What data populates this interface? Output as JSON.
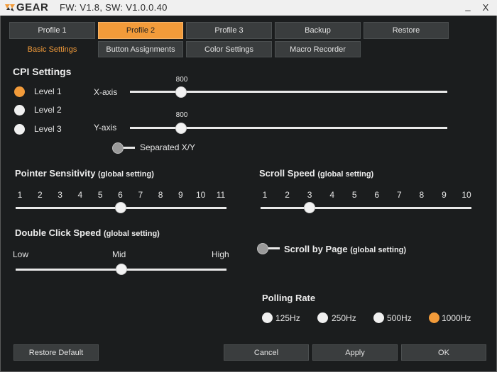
{
  "title_bar": {
    "logo_text": "GEAR",
    "version": "FW: V1.8, SW: V1.0.0.40",
    "minimize_label": "_",
    "close_label": "X"
  },
  "profile_tabs": [
    {
      "label": "Profile 1",
      "active": false
    },
    {
      "label": "Profile 2",
      "active": true
    },
    {
      "label": "Profile 3",
      "active": false
    },
    {
      "label": "Backup",
      "active": false
    },
    {
      "label": "Restore",
      "active": false
    }
  ],
  "settings_tabs": [
    {
      "label": "Basic Settings",
      "active": true
    },
    {
      "label": "Button Assignments",
      "active": false
    },
    {
      "label": "Color Settings",
      "active": false
    },
    {
      "label": "Macro Recorder",
      "active": false
    }
  ],
  "cpi": {
    "heading": "CPI Settings",
    "levels": [
      {
        "label": "Level 1",
        "selected": true
      },
      {
        "label": "Level 2",
        "selected": false
      },
      {
        "label": "Level 3",
        "selected": false
      }
    ],
    "x_axis": {
      "label": "X-axis",
      "value": "800",
      "fraction": 0.16
    },
    "y_axis": {
      "label": "Y-axis",
      "value": "800",
      "fraction": 0.16
    },
    "separated_label": "Separated X/Y"
  },
  "pointer": {
    "heading": "Pointer Sensitivity",
    "note": "(global setting)",
    "ticks": [
      "1",
      "2",
      "3",
      "4",
      "5",
      "6",
      "7",
      "8",
      "9",
      "10",
      "11"
    ],
    "selected_index": 5
  },
  "scroll": {
    "heading": "Scroll Speed",
    "note": "(global setting)",
    "ticks": [
      "1",
      "2",
      "3",
      "4",
      "5",
      "6",
      "7",
      "8",
      "9",
      "10"
    ],
    "selected_index": 2,
    "by_page_label": "Scroll by Page",
    "by_page_note": "(global setting)"
  },
  "double_click": {
    "heading": "Double Click Speed",
    "note": "(global setting)",
    "low": "Low",
    "mid": "Mid",
    "high": "High",
    "fraction": 0.5
  },
  "polling": {
    "heading": "Polling Rate",
    "options": [
      {
        "label": "125Hz",
        "selected": false
      },
      {
        "label": "250Hz",
        "selected": false
      },
      {
        "label": "500Hz",
        "selected": false
      },
      {
        "label": "1000Hz",
        "selected": true
      }
    ]
  },
  "footer": {
    "restore_default": "Restore Default",
    "cancel": "Cancel",
    "apply": "Apply",
    "ok": "OK"
  },
  "colors": {
    "accent": "#f29b3a",
    "background": "#1b1d1e",
    "button": "#3a3d3e"
  }
}
